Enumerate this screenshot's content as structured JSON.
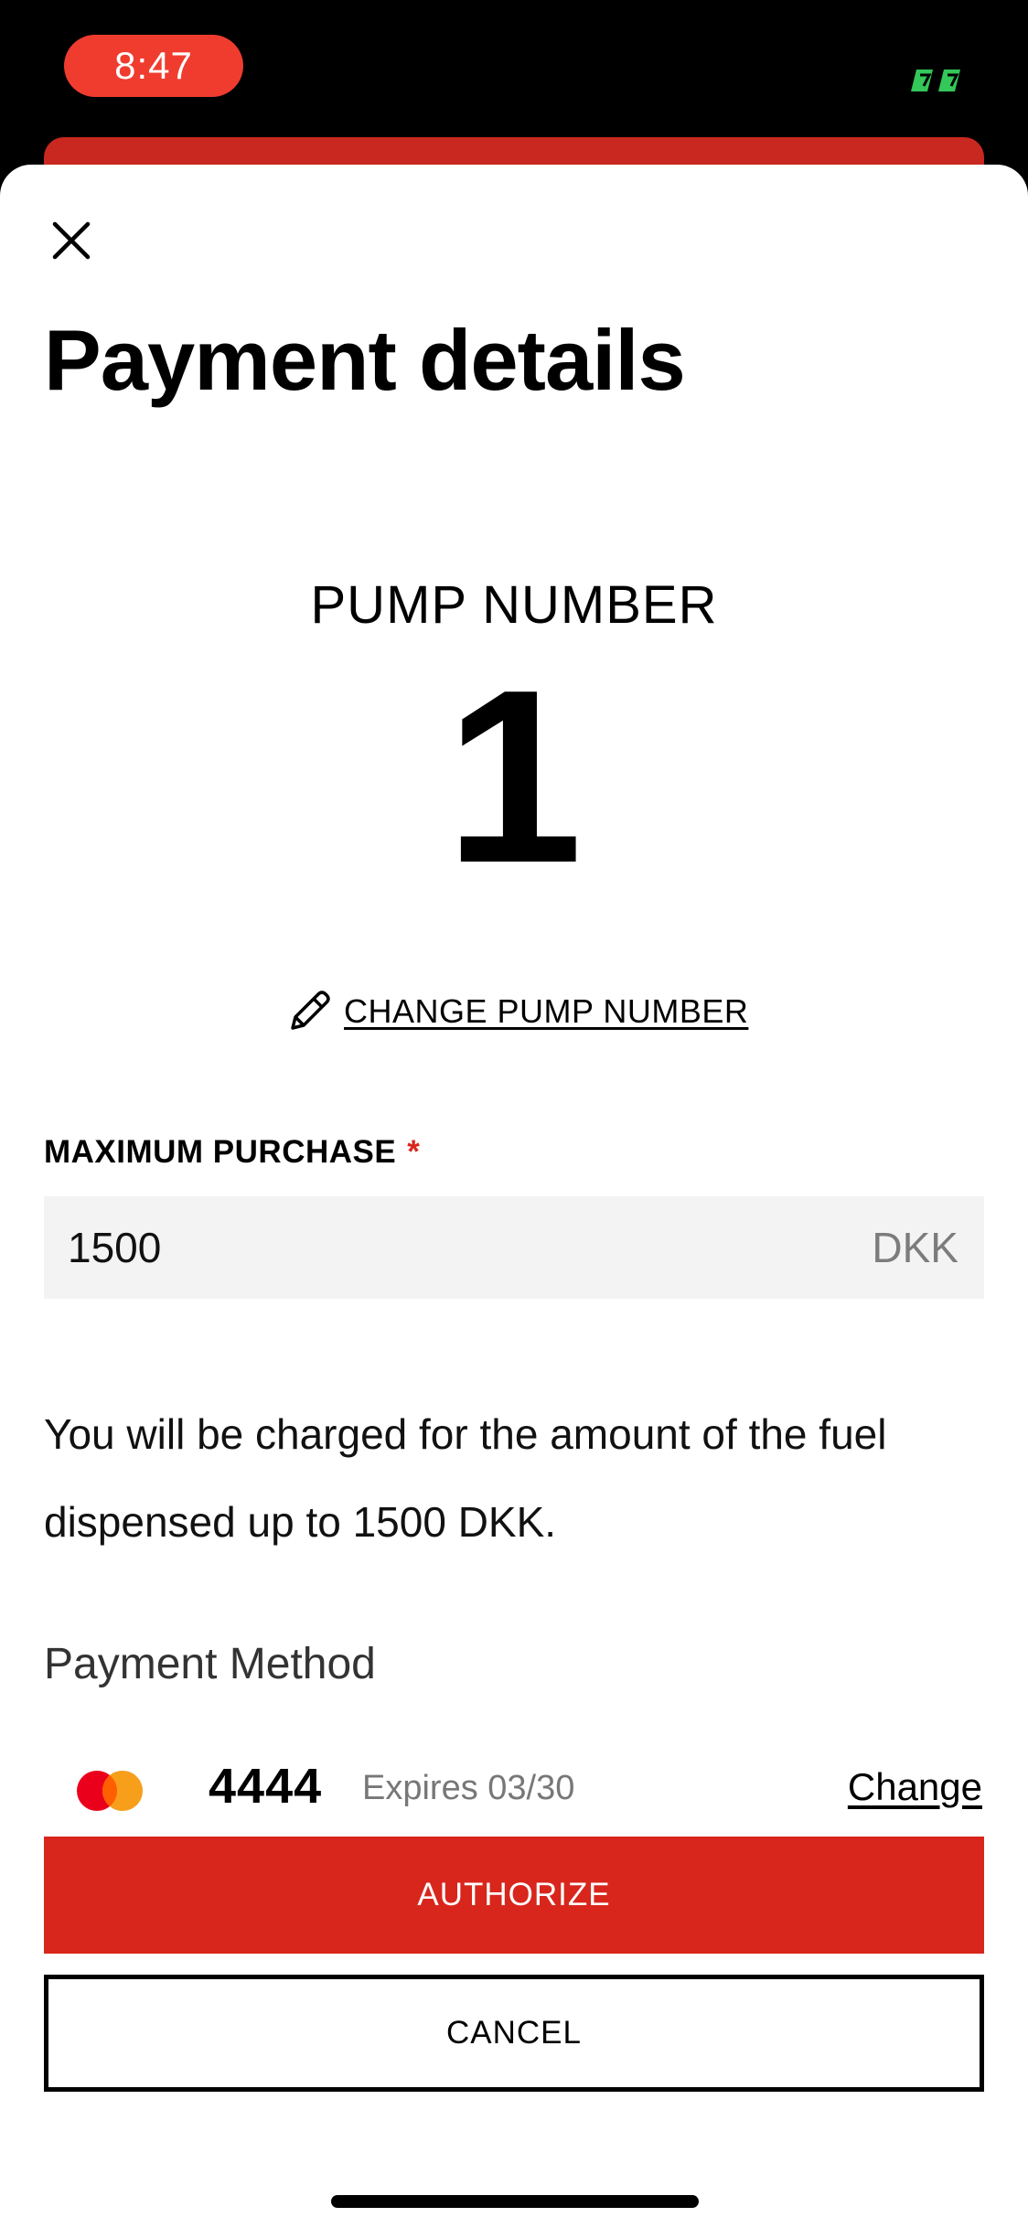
{
  "status_bar": {
    "time": "8:47",
    "time_pill_color": "#ef3c2f",
    "indicator_color": "#34c759"
  },
  "header": {
    "close_icon": "close-icon",
    "title": "Payment details"
  },
  "pump": {
    "label": "PUMP NUMBER",
    "number": "1",
    "change_icon": "pencil-icon",
    "change_label": "CHANGE PUMP NUMBER"
  },
  "max_purchase": {
    "label": "MAXIMUM PURCHASE",
    "required_marker": "*",
    "value": "1500",
    "unit": "DKK"
  },
  "charge_note": "You will be charged for the amount of the fuel dispensed up to 1500 DKK.",
  "payment_method": {
    "heading": "Payment Method",
    "card_brand_icon": "mastercard-icon",
    "last4": "4444",
    "expiry": "Expires 03/30",
    "change_label": "Change"
  },
  "actions": {
    "authorize_label": "AUTHORIZE",
    "cancel_label": "CANCEL",
    "accent_color": "#d8261c"
  }
}
